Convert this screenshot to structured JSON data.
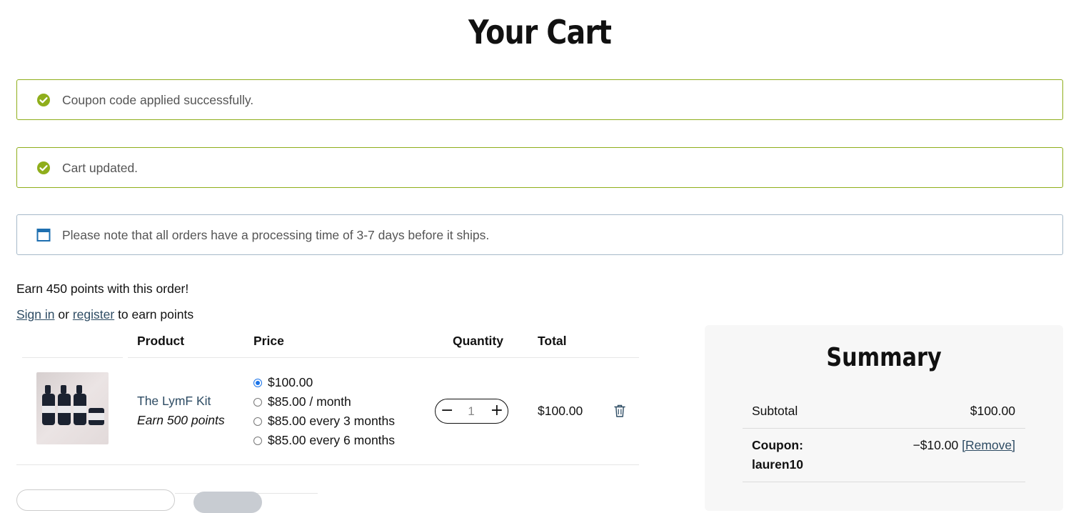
{
  "page": {
    "title": "Your Cart"
  },
  "notices": {
    "coupon": {
      "message": "Coupon code applied successfully."
    },
    "cart": {
      "message": "Cart updated."
    },
    "info": {
      "message": "Please note that all orders have a processing time of 3-7 days before it ships."
    }
  },
  "loyalty": {
    "earn_text": "Earn 450 points with this order!",
    "sign_in": "Sign in",
    "or": "or",
    "register": "register",
    "suffix": "to earn points"
  },
  "table": {
    "headers": {
      "product": "Product",
      "price": "Price",
      "quantity": "Quantity",
      "total": "Total"
    },
    "items": [
      {
        "name": "The LymF Kit",
        "points": "Earn 500 points",
        "price_options": [
          {
            "label": "$100.00",
            "selected": true
          },
          {
            "label": "$85.00 / month",
            "selected": false
          },
          {
            "label": "$85.00 every 3 months",
            "selected": false
          },
          {
            "label": "$85.00 every 6 months",
            "selected": false
          }
        ],
        "quantity": "1",
        "total": "$100.00"
      }
    ]
  },
  "summary": {
    "title": "Summary",
    "subtotal_label": "Subtotal",
    "subtotal_value": "$100.00",
    "coupon_label_1": "Coupon:",
    "coupon_label_2": "lauren10",
    "coupon_value": "−$10.00",
    "remove_label": "[Remove]"
  },
  "colors": {
    "success_border": "#8fae1b",
    "success_icon": "#8fae1b",
    "info_border": "#a6b9c9",
    "info_icon": "#1e6fb0",
    "link": "#2d4b63",
    "radio_selected": "#1a73e8"
  },
  "icons": {
    "success": "check-circle-icon",
    "info": "calendar-icon",
    "delete": "trash-icon"
  }
}
